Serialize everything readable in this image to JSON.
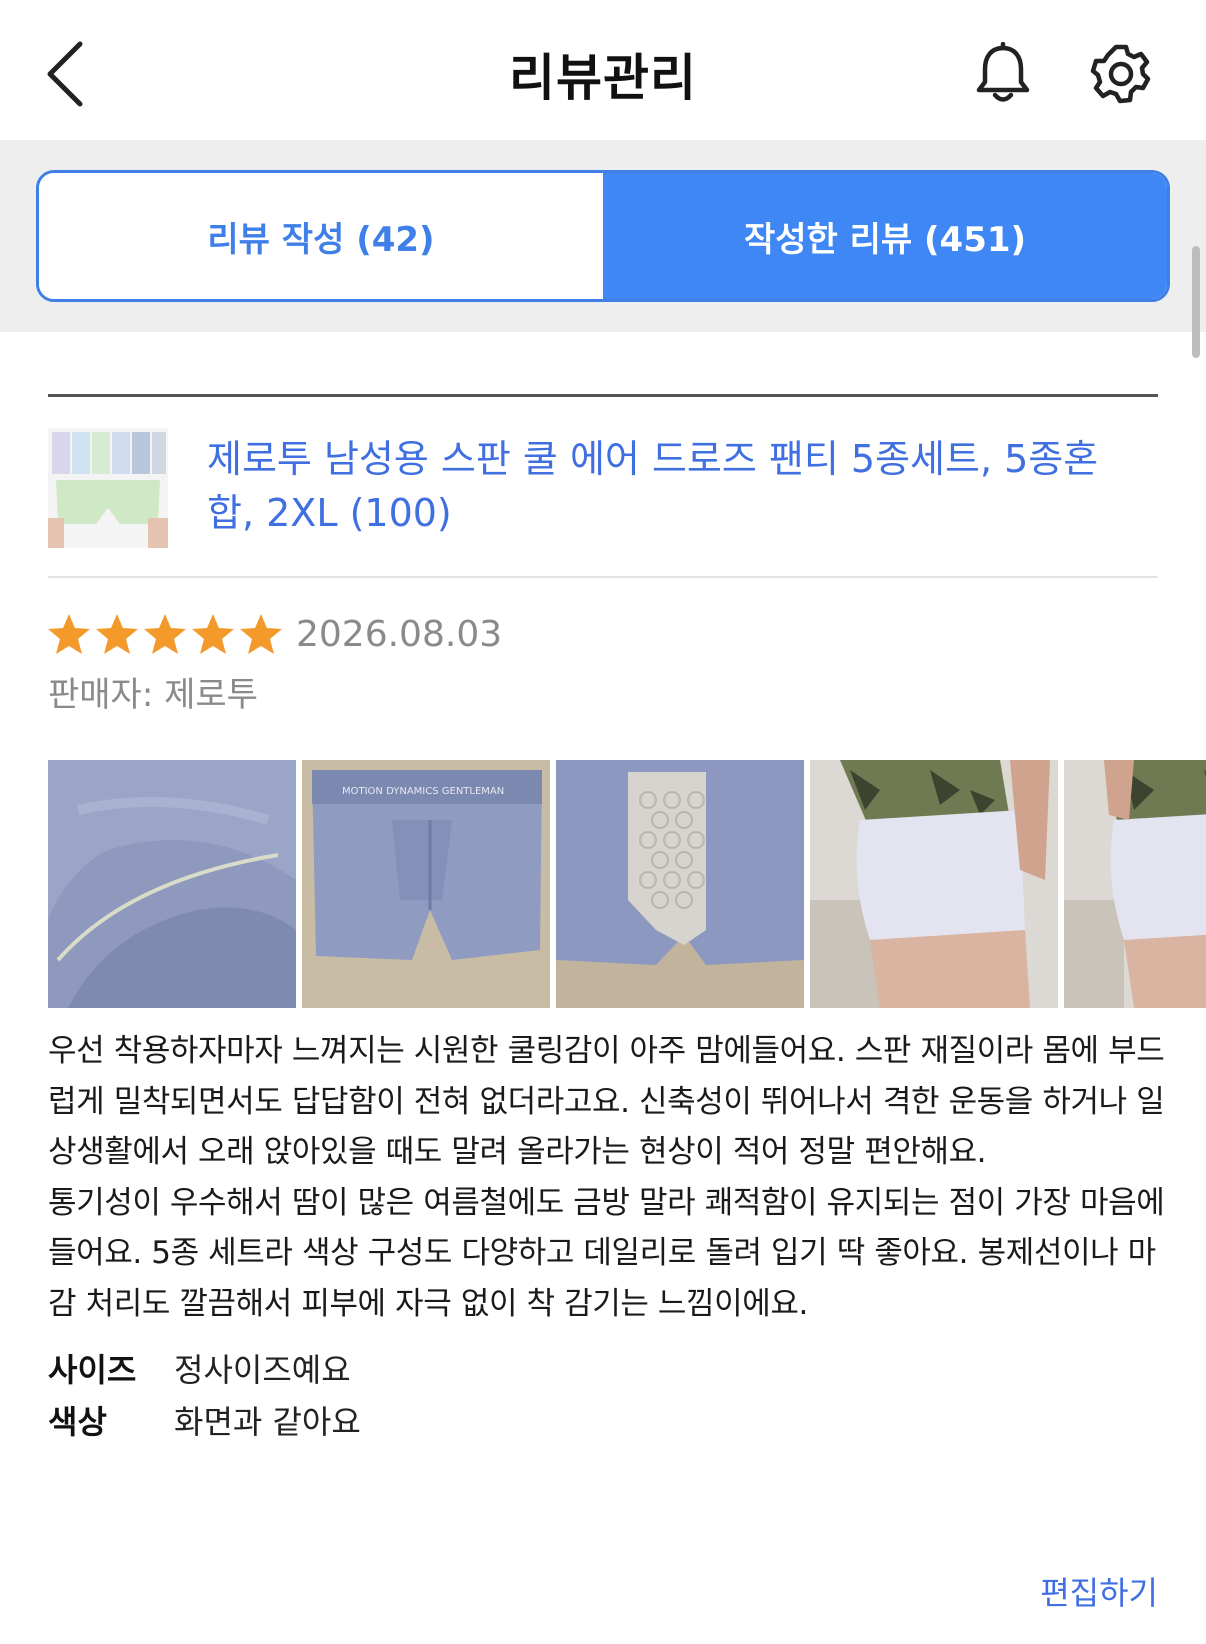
{
  "header": {
    "title": "리뷰관리",
    "icons": {
      "back": "chevron-left-icon",
      "notifications": "bell-icon",
      "settings": "gear-icon"
    }
  },
  "tabs": [
    {
      "label": "리뷰 작성 (42)",
      "active": false
    },
    {
      "label": "작성한 리뷰 (451)",
      "active": true
    }
  ],
  "colors": {
    "accent": "#3f87f5",
    "link": "#3f6fe0",
    "star": "#f39a2b",
    "muted": "#8a8a8a"
  },
  "review": {
    "product_name": "제로투 남성용 스판 쿨 에어 드로즈 팬티 5종세트, 5종혼합, 2XL (100)",
    "rating": 5,
    "rating_max": 5,
    "date": "2026.08.03",
    "seller": "판매자: 제로투",
    "photos": [
      {
        "icon": "photo-fabric-closeup"
      },
      {
        "icon": "photo-underwear-front"
      },
      {
        "icon": "photo-underwear-inner"
      },
      {
        "icon": "photo-wearing-side"
      },
      {
        "icon": "photo-wearing-partial"
      }
    ],
    "photo_band_text": "MOTION DYNAMICS GENTLEMAN",
    "body": "우선 착용하자마자 느껴지는 시원한 쿨링감이 아주 맘에들어요. 스판 재질이라 몸에 부드럽게 밀착되면서도 답답함이 전혀 없더라고요. 신축성이 뛰어나서 격한 운동을 하거나 일상생활에서 오래 앉아있을 때도 말려 올라가는 현상이 적어 정말 편안해요.\n통기성이 우수해서 땀이 많은 여름철에도 금방 말라 쾌적함이 유지되는 점이 가장 마음에 들어요. 5종 세트라 색상 구성도 다양하고 데일리로 돌려 입기 딱 좋아요. 봉제선이나 마감 처리도 깔끔해서 피부에 자극 없이 착 감기는 느낌이에요.",
    "attributes": [
      {
        "key": "사이즈",
        "value": "정사이즈예요"
      },
      {
        "key": "색상",
        "value": "화면과 같아요"
      }
    ],
    "edit_label": "편집하기"
  }
}
